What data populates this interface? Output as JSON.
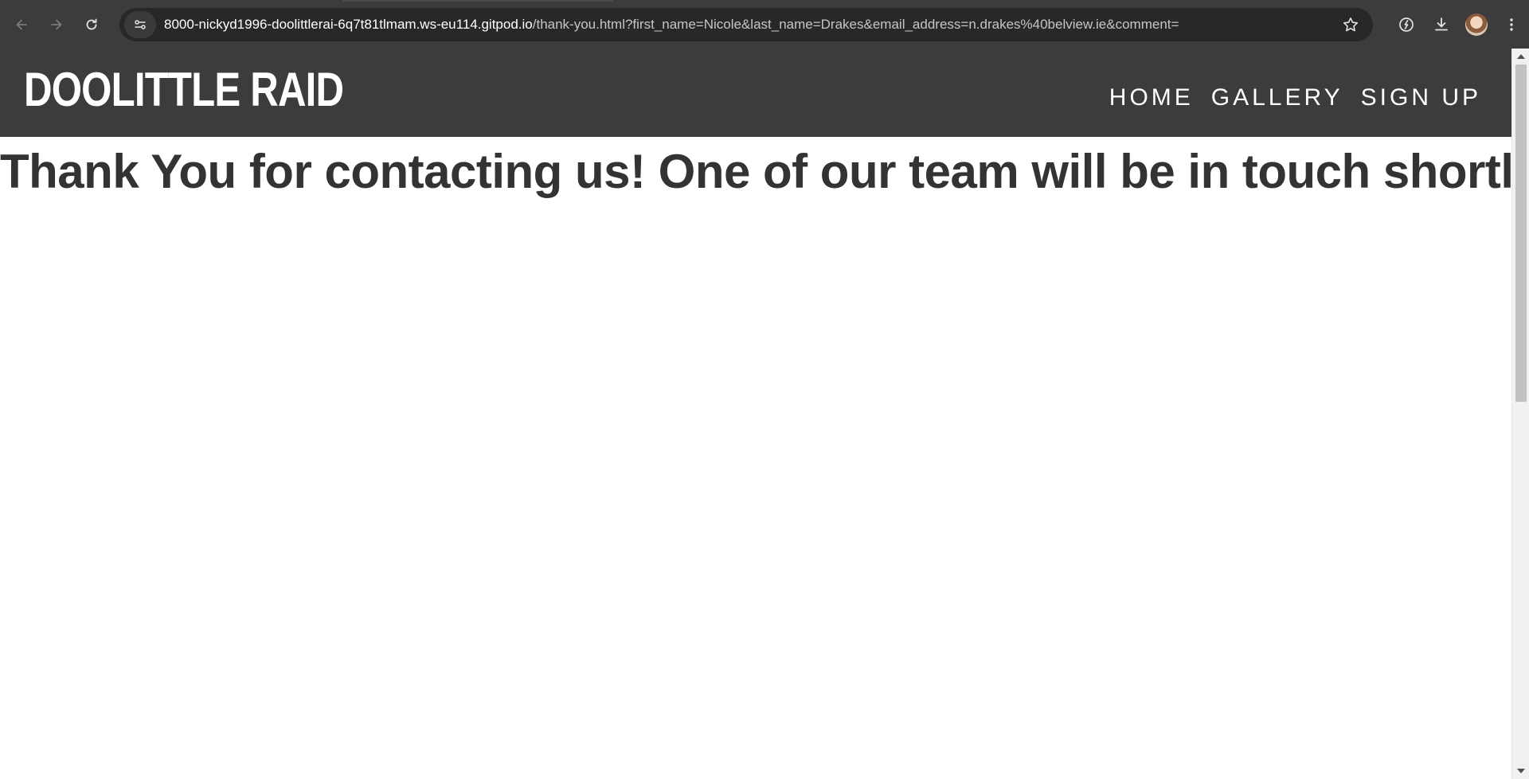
{
  "browser": {
    "url_host": "8000-nickyd1996-doolittlerai-6q7t81tlmam.ws-eu114.gitpod.io",
    "url_path": "/thank-you.html?first_name=Nicole&last_name=Drakes&email_address=n.drakes%40belview.ie&comment=",
    "icons": {
      "back": "back-arrow-icon",
      "forward": "forward-arrow-icon",
      "reload": "reload-icon",
      "site_info": "site-info-icon",
      "bookmark": "star-icon",
      "extension": "extension-icon",
      "download": "download-icon",
      "menu": "kebab-menu-icon"
    }
  },
  "site": {
    "logo": "DOOLITTLE RAID",
    "nav": {
      "home": "HOME",
      "gallery": "GALLERY",
      "sign_up": "SIGN UP"
    },
    "header_color": "#3c3c3c"
  },
  "main": {
    "message": "Thank You for contacting us! One of our team will be in touch shortly!"
  }
}
